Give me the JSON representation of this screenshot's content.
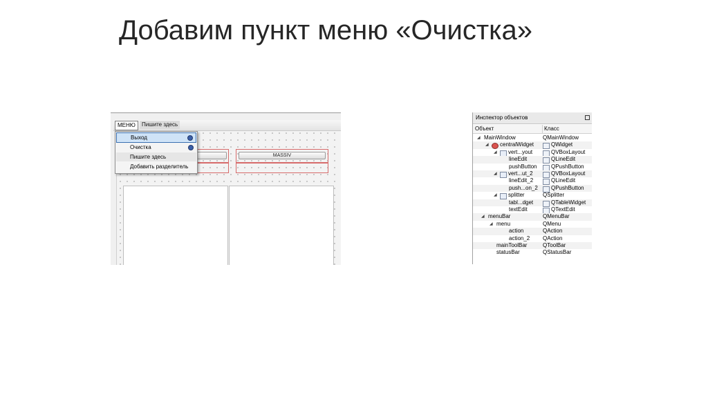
{
  "slide": {
    "title": "Добавим пункт меню «Очистка»"
  },
  "designer": {
    "menubar": {
      "root_label": "МЕНЮ",
      "type_here": "Пишите здесь"
    },
    "dropdown_items": [
      {
        "label": "Выход",
        "state": "selected",
        "icon": "action-icon"
      },
      {
        "label": "Очистка",
        "state": "normal",
        "icon": "action-icon"
      },
      {
        "label": "Пишите здесь",
        "state": "placeholder"
      },
      {
        "label": "Добавить разделитель",
        "state": "normal"
      }
    ],
    "button_right": "MASSIV"
  },
  "inspector": {
    "title": "Инспектор объектов",
    "col_object": "Объект",
    "col_class": "Класс",
    "rows": [
      {
        "name": "MainWindow",
        "cls": "QMainWindow",
        "level": 0,
        "arrow": true,
        "icon": "",
        "cls_icon": false
      },
      {
        "name": "centralWidget",
        "cls": "QWidget",
        "level": 1,
        "arrow": true,
        "icon": "widget-icon",
        "cls_icon": true
      },
      {
        "name": "vert...yout",
        "cls": "QVBoxLayout",
        "level": 2,
        "arrow": true,
        "icon": "layout-icon",
        "cls_icon": true
      },
      {
        "name": "lineEdit",
        "cls": "QLineEdit",
        "level": 3,
        "arrow": false,
        "icon": "",
        "cls_icon": true
      },
      {
        "name": "pushButton",
        "cls": "QPushButton",
        "level": 3,
        "arrow": false,
        "icon": "",
        "cls_icon": true
      },
      {
        "name": "vert...ut_2",
        "cls": "QVBoxLayout",
        "level": 2,
        "arrow": true,
        "icon": "layout-icon",
        "cls_icon": true
      },
      {
        "name": "lineEdit_2",
        "cls": "QLineEdit",
        "level": 3,
        "arrow": false,
        "icon": "",
        "cls_icon": true
      },
      {
        "name": "push...on_2",
        "cls": "QPushButton",
        "level": 3,
        "arrow": false,
        "icon": "",
        "cls_icon": true
      },
      {
        "name": "splitter",
        "cls": "QSplitter",
        "level": 2,
        "arrow": true,
        "icon": "splitter-icon",
        "cls_icon": false
      },
      {
        "name": "tabl...dget",
        "cls": "QTableWidget",
        "level": 3,
        "arrow": false,
        "icon": "",
        "cls_icon": true
      },
      {
        "name": "textEdit",
        "cls": "QTextEdit",
        "level": 3,
        "arrow": false,
        "icon": "",
        "cls_icon": true
      },
      {
        "name": "menuBar",
        "cls": "QMenuBar",
        "level": 0.5,
        "arrow": true,
        "icon": "",
        "cls_icon": false
      },
      {
        "name": "menu",
        "cls": "QMenu",
        "level": 1.5,
        "arrow": true,
        "icon": "",
        "cls_icon": false
      },
      {
        "name": "action",
        "cls": "QAction",
        "level": 3,
        "arrow": false,
        "icon": "",
        "cls_icon": false
      },
      {
        "name": "action_2",
        "cls": "QAction",
        "level": 3,
        "arrow": false,
        "icon": "",
        "cls_icon": false
      },
      {
        "name": "mainToolBar",
        "cls": "QToolBar",
        "level": 1.5,
        "arrow": false,
        "icon": "",
        "cls_icon": false
      },
      {
        "name": "statusBar",
        "cls": "QStatusBar",
        "level": 1.5,
        "arrow": false,
        "icon": "",
        "cls_icon": false
      }
    ]
  }
}
